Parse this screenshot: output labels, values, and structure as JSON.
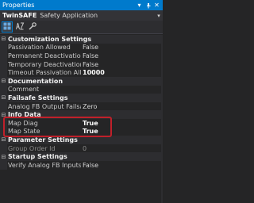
{
  "window": {
    "title": "Properties",
    "controls": {
      "dropdown": "▾",
      "pin": "⊣",
      "close": "✕"
    }
  },
  "selector": {
    "object_name": "TwinSAFE",
    "object_type": "Safety Application",
    "dropdown_glyph": "▾"
  },
  "toolbar": {
    "buttons": [
      {
        "icon": "categorized-icon",
        "active": true
      },
      {
        "icon": "alphabetical-icon",
        "active": false
      },
      {
        "icon": "wrench-icon",
        "active": false
      }
    ]
  },
  "grid": {
    "categories": [
      {
        "label": "Customization Settings",
        "toggle": "⊟",
        "properties": [
          {
            "name": "Passivation Allowed",
            "value": "False"
          },
          {
            "name": "Permanent Deactivation A",
            "value": "False"
          },
          {
            "name": "Temporary Deactivation A",
            "value": "False"
          },
          {
            "name": "Timeout Passivation Allov",
            "value": "10000"
          }
        ]
      },
      {
        "label": "Documentation",
        "toggle": "⊟",
        "properties": [
          {
            "name": "Comment",
            "value": ""
          }
        ]
      },
      {
        "label": "Failsafe Settings",
        "toggle": "⊟",
        "properties": [
          {
            "name": "Analog FB Output Failsafe",
            "value": "Zero"
          }
        ]
      },
      {
        "label": "Info Data",
        "toggle": "⊟",
        "properties": [
          {
            "name": "Map Diag",
            "value": "True"
          },
          {
            "name": "Map State",
            "value": "True"
          }
        ]
      },
      {
        "label": "Parameter Settings",
        "toggle": "⊟",
        "properties": [
          {
            "name": "Group Order Id",
            "value": "0"
          }
        ]
      },
      {
        "label": "Startup Settings",
        "toggle": "⊟",
        "properties": [
          {
            "name": "Verify Analog FB Inputs at",
            "value": "False"
          }
        ]
      }
    ]
  },
  "colors": {
    "accent": "#007acc",
    "highlight_border": "#c0202a",
    "background": "#252526"
  }
}
